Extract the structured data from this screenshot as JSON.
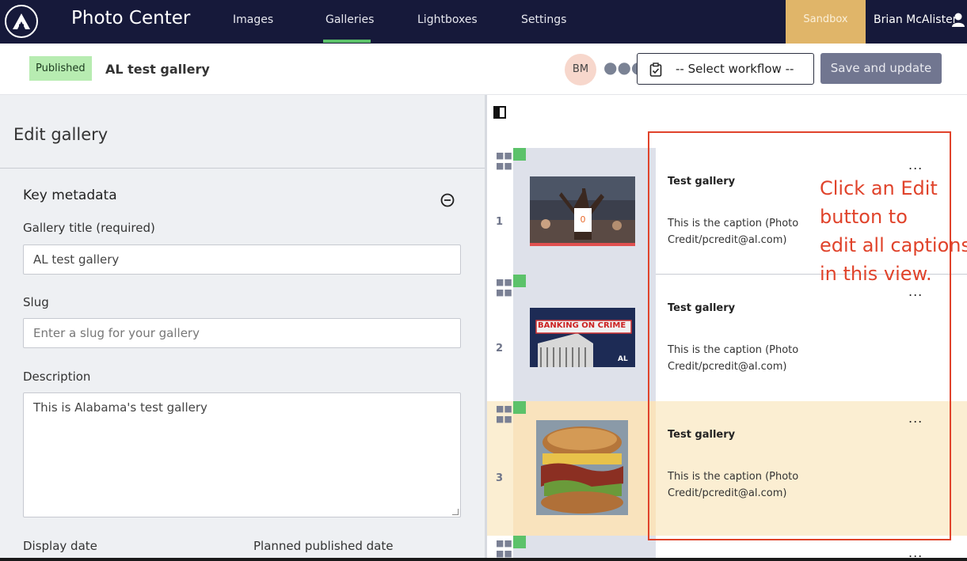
{
  "app": {
    "title": "Photo Center",
    "nav": [
      "Images",
      "Galleries",
      "Lightboxes",
      "Settings"
    ],
    "active_nav": "Galleries",
    "environment": "Sandbox",
    "user": "Brian McAlister"
  },
  "header": {
    "status_badge": "Published",
    "gallery_name": "AL test gallery",
    "avatar_initials": "BM",
    "workflow_select": "-- Select workflow --",
    "save_button": "Save and update"
  },
  "edit_panel": {
    "title": "Edit gallery",
    "section_title": "Key metadata",
    "fields": {
      "gallery_title_label": "Gallery title (required)",
      "gallery_title_value": "AL test gallery",
      "slug_label": "Slug",
      "slug_placeholder": "Enter a slug for your gallery",
      "description_label": "Description",
      "description_value": "This is Alabama's test gallery",
      "display_date_label": "Display date",
      "planned_date_label": "Planned published date"
    }
  },
  "gallery_items": [
    {
      "number": "1",
      "title": "Test gallery",
      "caption": "This is the caption (Photo Credit/pcredit@al.com)",
      "image": "basketball-player-photo",
      "selected": false
    },
    {
      "number": "2",
      "title": "Test gallery",
      "caption": "This is the caption (Photo Credit/pcredit@al.com)",
      "image": "banking-on-crime-graphic",
      "selected": false,
      "image_text": "BANKING ON CRIME",
      "image_logo": "AL"
    },
    {
      "number": "3",
      "title": "Test gallery",
      "caption": "This is the caption (Photo Credit/pcredit@al.com)",
      "image": "sandwich-photo",
      "selected": true
    }
  ],
  "annotation": {
    "text": "Click an Edit\nbutton to\nedit all captions\nin this view.",
    "color": "#e0432b"
  },
  "colors": {
    "nav_bg": "#16193a",
    "active_underline": "#5cc26a",
    "sandbox_bg": "#e0b569",
    "published_badge": "#b7ecb1",
    "selected_row": "#fbeed2"
  }
}
